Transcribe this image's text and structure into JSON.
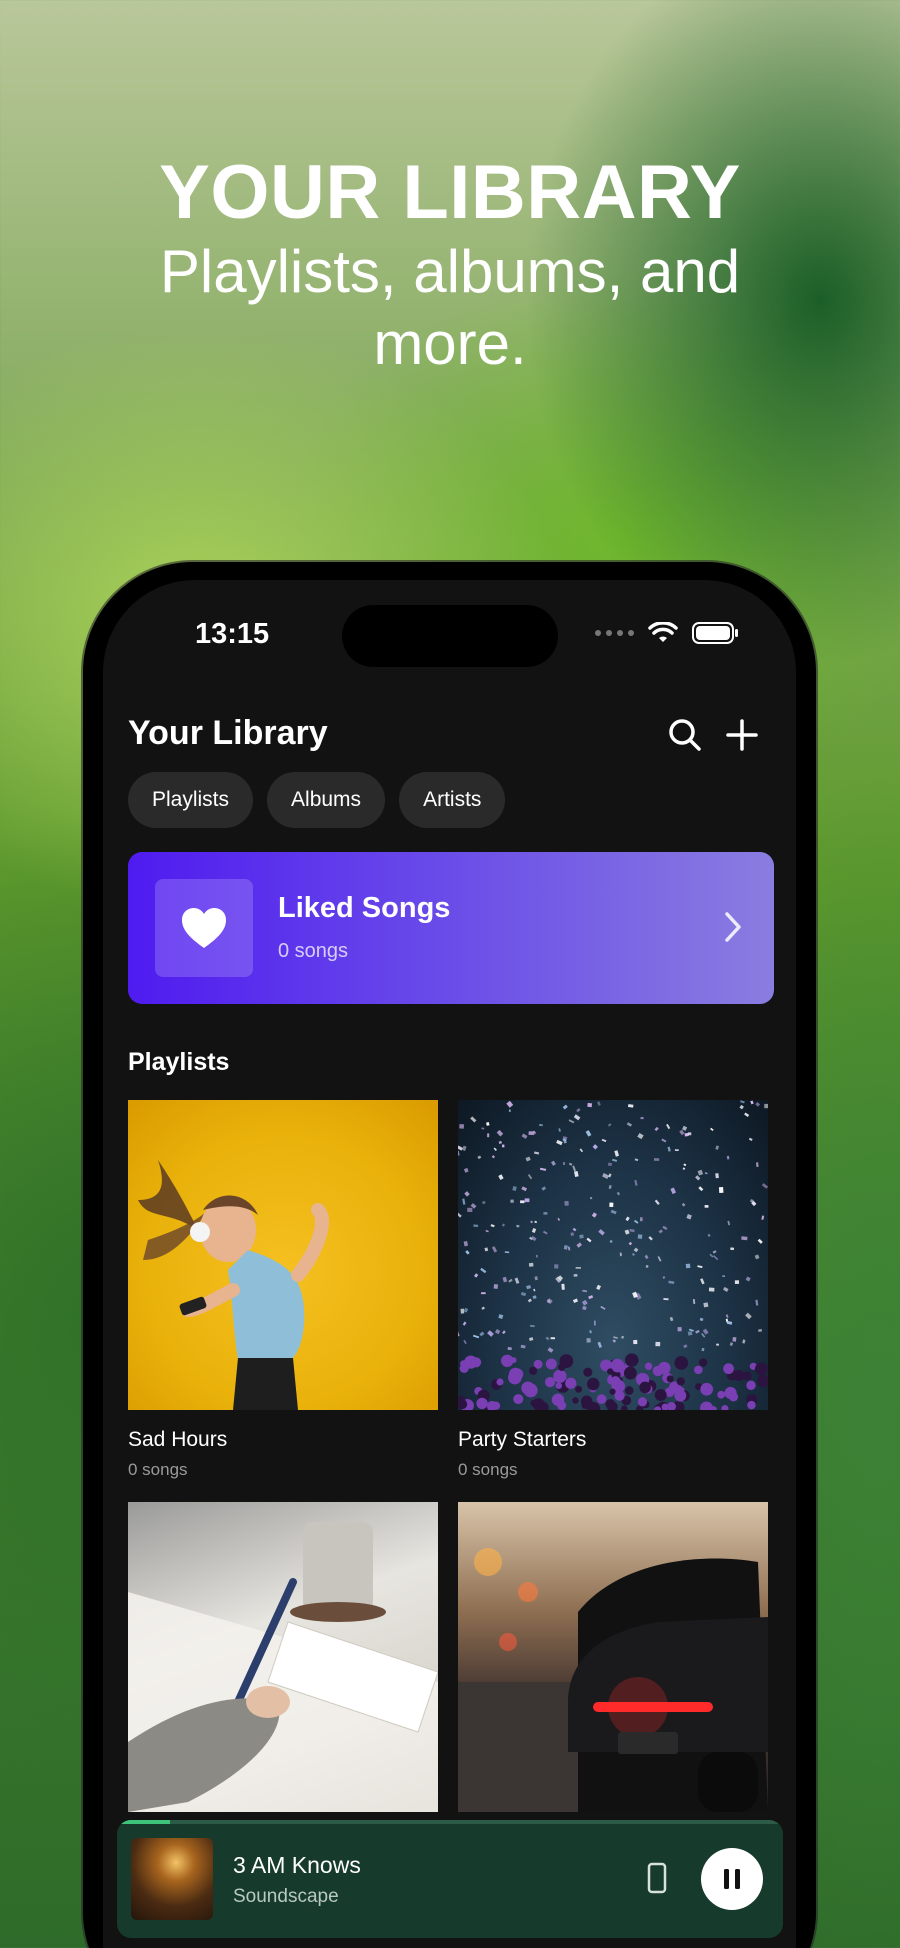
{
  "hero": {
    "title": "YOUR LIBRARY",
    "subtitle": "Playlists, albums, and more."
  },
  "status_bar": {
    "time": "13:15"
  },
  "library": {
    "title": "Your Library",
    "actions": [
      "search-icon",
      "plus-icon"
    ],
    "filters": [
      "Playlists",
      "Albums",
      "Artists"
    ]
  },
  "liked_songs": {
    "title": "Liked Songs",
    "count": "0 songs",
    "gradient": [
      "#4f1bf0",
      "#8a7de0"
    ]
  },
  "playlists_section": {
    "title": "Playlists",
    "items": [
      {
        "title": "Sad Hours",
        "count": "0 songs"
      },
      {
        "title": "Party Starters",
        "count": "0 songs"
      },
      {
        "title": "",
        "count": ""
      },
      {
        "title": "",
        "count": ""
      }
    ]
  },
  "now_playing": {
    "title": "3 AM Knows",
    "artist": "Soundscape",
    "progress": 0.08,
    "accent": "#3ec47a"
  }
}
